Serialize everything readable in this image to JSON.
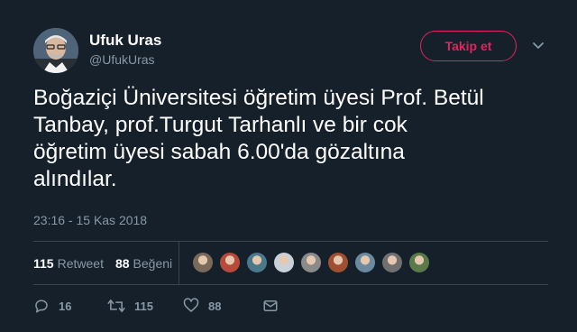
{
  "profile": {
    "name": "Ufuk Uras",
    "handle": "@UfukUras"
  },
  "follow_button": {
    "label": "Takip et"
  },
  "tweet": {
    "text": "Boğaziçi Üniversitesi öğretim üyesi Prof. Betül\nTanbay, prof.Turgut Tarhanlı ve bir cok\nöğretim üyesi sabah 6.00'da gözaltına\nalındılar.",
    "timestamp": "23:16 - 15 Kas 2018"
  },
  "stats": {
    "retweets_count": "115",
    "retweets_label": "Retweet",
    "likes_count": "88",
    "likes_label": "Beğeni"
  },
  "likers": [
    {
      "color": "#7a6a5a"
    },
    {
      "color": "#b84a3a"
    },
    {
      "color": "#4a7a8a"
    },
    {
      "color": "#c8d0d8"
    },
    {
      "color": "#8a8a8a"
    },
    {
      "color": "#a05030"
    },
    {
      "color": "#6a8aa0"
    },
    {
      "color": "#707070"
    },
    {
      "color": "#5a7a4a"
    }
  ],
  "actions": {
    "reply_count": "16",
    "retweet_count": "115",
    "like_count": "88"
  },
  "colors": {
    "background": "#15202b",
    "accent": "#e0245e",
    "muted": "#8899a6",
    "divider": "#38444d"
  }
}
